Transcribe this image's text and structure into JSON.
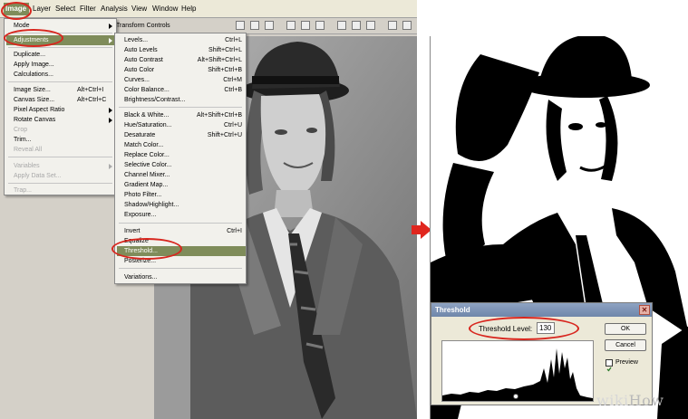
{
  "menubar": {
    "items": [
      "Image",
      "Layer",
      "Select",
      "Filter",
      "Analysis",
      "View",
      "Window",
      "Help"
    ]
  },
  "options_bar": {
    "label": "Transform Controls"
  },
  "image_menu": {
    "items": [
      {
        "label": "Mode",
        "submenu": true
      },
      {
        "label": "Adjustments",
        "submenu": true,
        "selected": true
      },
      {
        "label": "Duplicate..."
      },
      {
        "label": "Apply Image..."
      },
      {
        "label": "Calculations..."
      },
      {
        "label": "Image Size...",
        "shortcut": "Alt+Ctrl+I"
      },
      {
        "label": "Canvas Size...",
        "shortcut": "Alt+Ctrl+C"
      },
      {
        "label": "Pixel Aspect Ratio",
        "submenu": true
      },
      {
        "label": "Rotate Canvas",
        "submenu": true
      },
      {
        "label": "Crop",
        "disabled": true
      },
      {
        "label": "Trim..."
      },
      {
        "label": "Reveal All",
        "disabled": true
      },
      {
        "label": "Variables",
        "disabled": true,
        "submenu": true
      },
      {
        "label": "Apply Data Set...",
        "disabled": true
      },
      {
        "label": "Trap...",
        "disabled": true
      }
    ]
  },
  "adjustments_menu": {
    "items": [
      {
        "label": "Levels...",
        "shortcut": "Ctrl+L"
      },
      {
        "label": "Auto Levels",
        "shortcut": "Shift+Ctrl+L"
      },
      {
        "label": "Auto Contrast",
        "shortcut": "Alt+Shift+Ctrl+L"
      },
      {
        "label": "Auto Color",
        "shortcut": "Shift+Ctrl+B"
      },
      {
        "label": "Curves...",
        "shortcut": "Ctrl+M"
      },
      {
        "label": "Color Balance...",
        "shortcut": "Ctrl+B"
      },
      {
        "label": "Brightness/Contrast..."
      },
      {
        "label": "Black & White...",
        "shortcut": "Alt+Shift+Ctrl+B"
      },
      {
        "label": "Hue/Saturation...",
        "shortcut": "Ctrl+U"
      },
      {
        "label": "Desaturate",
        "shortcut": "Shift+Ctrl+U"
      },
      {
        "label": "Match Color..."
      },
      {
        "label": "Replace Color..."
      },
      {
        "label": "Selective Color..."
      },
      {
        "label": "Channel Mixer..."
      },
      {
        "label": "Gradient Map..."
      },
      {
        "label": "Photo Filter..."
      },
      {
        "label": "Shadow/Highlight..."
      },
      {
        "label": "Exposure..."
      },
      {
        "label": "Invert",
        "shortcut": "Ctrl+I"
      },
      {
        "label": "Equalize"
      },
      {
        "label": "Threshold...",
        "selected": true
      },
      {
        "label": "Posterize..."
      },
      {
        "label": "Variations..."
      }
    ]
  },
  "threshold_dialog": {
    "title": "Threshold",
    "level_label": "Threshold Level:",
    "level_value": "130",
    "ok_label": "OK",
    "cancel_label": "Cancel",
    "preview_label": "Preview",
    "preview_checked": true
  },
  "watermark": {
    "part1": "wiki",
    "part2": "How"
  },
  "colors": {
    "menu_highlight": "#7f8c5a",
    "annotation_red": "#d8261e",
    "arrow_red": "#e0261e"
  }
}
